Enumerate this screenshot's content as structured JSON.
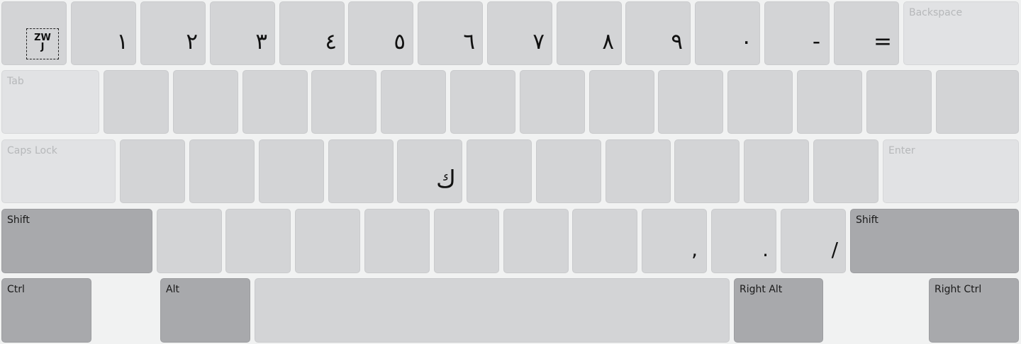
{
  "keyboard": {
    "row1": {
      "zwj_label_top": "ZW",
      "zwj_label_bottom": "J",
      "digits": [
        "١",
        "٢",
        "٣",
        "٤",
        "٥",
        "٦",
        "٧",
        "٨",
        "٩",
        "٠"
      ],
      "minus": "-",
      "equals": "=",
      "backspace": "Backspace"
    },
    "row2": {
      "tab": "Tab"
    },
    "row3": {
      "caps_lock": "Caps Lock",
      "g_key": "ك",
      "enter": "Enter"
    },
    "row4": {
      "shift_left": "Shift",
      "comma": ",",
      "period": ".",
      "slash": "/",
      "shift_right": "Shift"
    },
    "row5": {
      "ctrl": "Ctrl",
      "alt": "Alt",
      "right_alt": "Right Alt",
      "right_ctrl": "Right Ctrl"
    }
  }
}
